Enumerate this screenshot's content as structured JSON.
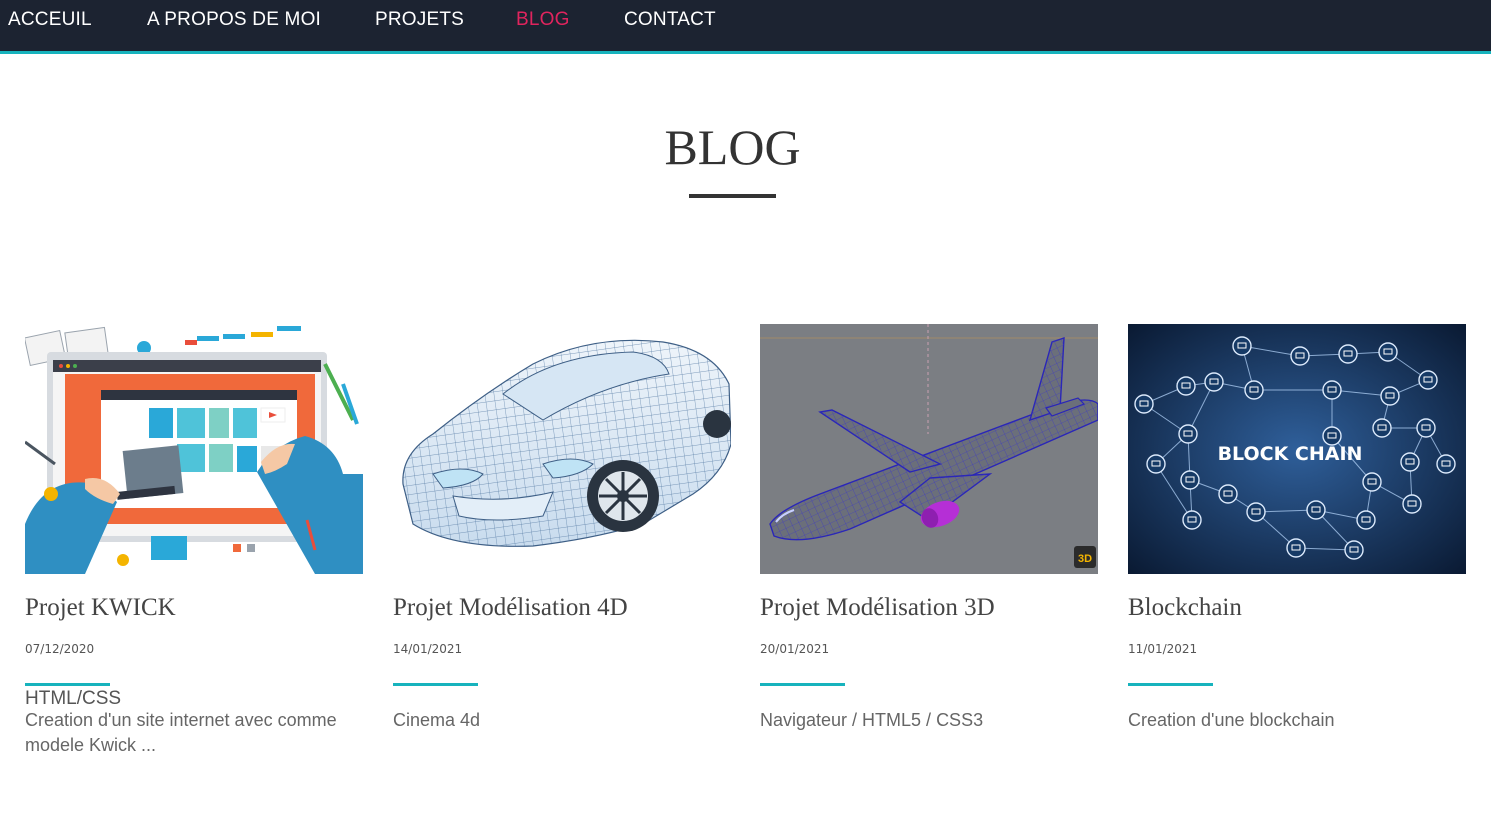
{
  "nav": {
    "items": [
      {
        "label": "ACCEUIL"
      },
      {
        "label": "A PROPOS DE MOI"
      },
      {
        "label": "PROJETS"
      },
      {
        "label": "BLOG"
      },
      {
        "label": "CONTACT"
      }
    ],
    "active_index": 3,
    "background": "#1c2331",
    "accent": "#17b3bd",
    "active_color": "#e0245e"
  },
  "page": {
    "title": "BLOG"
  },
  "cards": [
    {
      "title": "Projet KWICK",
      "date": "07/12/2020",
      "tag": "HTML/CSS",
      "description": "Creation d'un site internet avec comme modele Kwick ..."
    },
    {
      "title": "Projet Modélisation 4D",
      "date": "14/01/2021",
      "description": "Cinema 4d"
    },
    {
      "title": "Projet Modélisation 3D",
      "date": "20/01/2021",
      "description": "Navigateur / HTML5 / CSS3"
    },
    {
      "title": "Blockchain",
      "date": "11/01/2021",
      "description": "Creation d'une blockchain",
      "image_text": "BLOCK CHAIN"
    }
  ]
}
